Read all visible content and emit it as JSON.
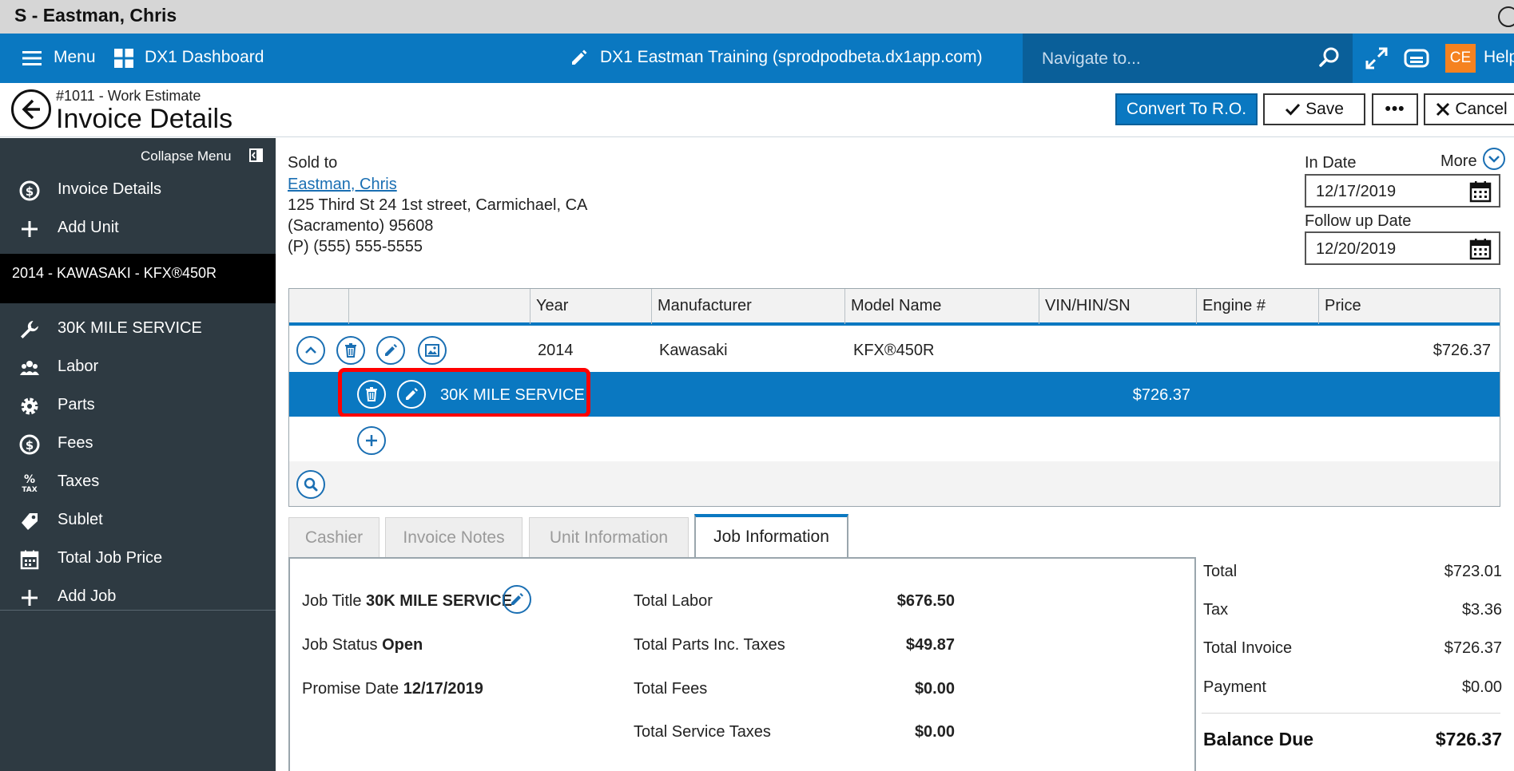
{
  "window": {
    "title": "S - Eastman, Chris"
  },
  "topnav": {
    "menu_label": "Menu",
    "dashboard_label": "DX1 Dashboard",
    "account_label": "DX1 Eastman Training (sprodpodbeta.dx1app.com)",
    "search_placeholder": "Navigate to...",
    "avatar_initials": "CE",
    "help_label": "Help",
    "bar_color": "#0a78c1",
    "avatar_color": "#f58220"
  },
  "header": {
    "subtitle": "#1011 - Work Estimate",
    "title": "Invoice Details",
    "convert_label": "Convert To R.O.",
    "save_label": "Save",
    "more_label": "•••",
    "cancel_label": "Cancel"
  },
  "sidebar": {
    "collapse_label": "Collapse Menu",
    "items_top": [
      {
        "icon": "dollar-circle-icon",
        "label": "Invoice Details"
      },
      {
        "icon": "plus-icon",
        "label": "Add Unit"
      }
    ],
    "unit_label": "2014 - KAWASAKI - KFX®450R",
    "items_job": [
      {
        "icon": "wrench-icon",
        "label": "30K MILE SERVICE"
      },
      {
        "icon": "people-icon",
        "label": "Labor"
      },
      {
        "icon": "gear-icon",
        "label": "Parts"
      },
      {
        "icon": "dollar-circle-icon",
        "label": "Fees"
      },
      {
        "icon": "percent-tax-icon",
        "label": "Taxes"
      },
      {
        "icon": "tag-icon",
        "label": "Sublet"
      },
      {
        "icon": "calculator-icon",
        "label": "Total Job Price"
      },
      {
        "icon": "plus-icon",
        "label": "Add Job"
      }
    ]
  },
  "sold_to": {
    "label": "Sold to",
    "name": "Eastman, Chris",
    "address_line1": "125 Third St 24 1st street, Carmichael, CA",
    "address_line2": "(Sacramento) 95608",
    "phone": "(P) (555) 555-5555"
  },
  "dates": {
    "more_label": "More",
    "in_date_label": "In Date",
    "in_date": "12/17/2019",
    "follow_up_label": "Follow up Date",
    "follow_up_date": "12/20/2019"
  },
  "unit_table": {
    "columns": [
      "Year",
      "Manufacturer",
      "Model Name",
      "VIN/HIN/SN",
      "Engine #",
      "Price"
    ],
    "unit_row": {
      "year": "2014",
      "manufacturer": "Kawasaki",
      "model": "KFX®450R",
      "vin": "",
      "engine": "",
      "price": "$726.37"
    },
    "job_row": {
      "name": "30K MILE SERVICE",
      "price": "$726.37"
    }
  },
  "tabs": [
    {
      "label": "Cashier",
      "active": false
    },
    {
      "label": "Invoice Notes",
      "active": false
    },
    {
      "label": "Unit Information",
      "active": false
    },
    {
      "label": "Job Information",
      "active": true
    }
  ],
  "job_info": {
    "title_label": "Job Title",
    "title_value": "30K MILE SERVICE",
    "status_label": "Job Status",
    "status_value": "Open",
    "promise_label": "Promise Date",
    "promise_value": "12/17/2019",
    "totals": [
      {
        "label": "Total Labor",
        "value": "$676.50"
      },
      {
        "label": "Total Parts Inc. Taxes",
        "value": "$49.87"
      },
      {
        "label": "Total Fees",
        "value": "$0.00"
      },
      {
        "label": "Total Service Taxes",
        "value": "$0.00"
      }
    ]
  },
  "invoice_totals": {
    "rows": [
      {
        "label": "Total",
        "value": "$723.01"
      },
      {
        "label": "Tax",
        "value": "$3.36"
      },
      {
        "label": "Total Invoice",
        "value": "$726.37"
      },
      {
        "label": "Payment",
        "value": "$0.00"
      }
    ],
    "balance_label": "Balance Due",
    "balance_value": "$726.37"
  }
}
